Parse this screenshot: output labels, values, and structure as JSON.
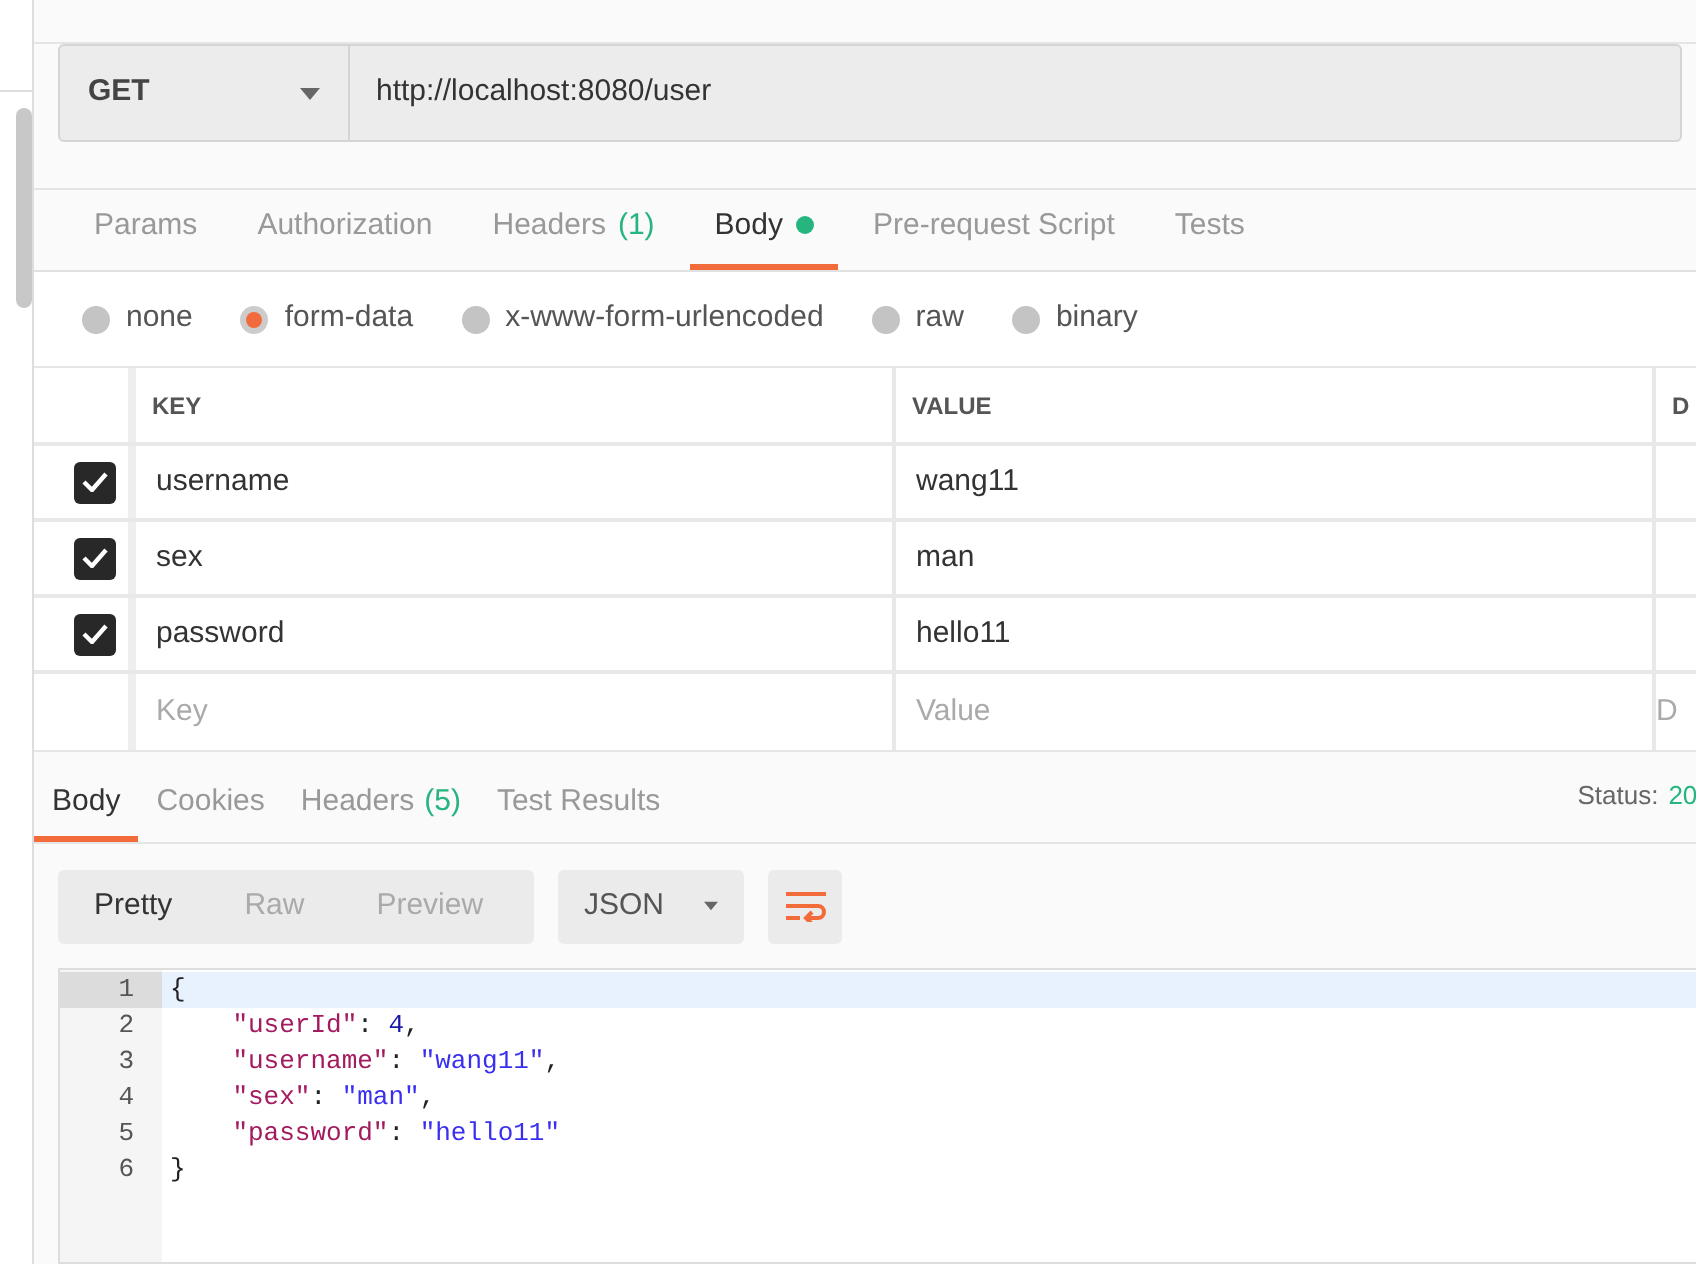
{
  "request": {
    "method": "GET",
    "url": "http://localhost:8080/user"
  },
  "request_tabs": [
    {
      "label": "Params",
      "selected": false
    },
    {
      "label": "Authorization",
      "selected": false
    },
    {
      "label": "Headers",
      "count": "(1)",
      "selected": false
    },
    {
      "label": "Body",
      "dot": true,
      "selected": true
    },
    {
      "label": "Pre-request Script",
      "selected": false
    },
    {
      "label": "Tests",
      "selected": false
    }
  ],
  "body_types": [
    {
      "label": "none",
      "selected": false
    },
    {
      "label": "form-data",
      "selected": true
    },
    {
      "label": "x-www-form-urlencoded",
      "selected": false
    },
    {
      "label": "raw",
      "selected": false
    },
    {
      "label": "binary",
      "selected": false
    }
  ],
  "params_table": {
    "columns": [
      "KEY",
      "VALUE",
      "D"
    ],
    "rows": [
      {
        "key": "username",
        "value": "wang11",
        "checked": true
      },
      {
        "key": "sex",
        "value": "man",
        "checked": true
      },
      {
        "key": "password",
        "value": "hello11",
        "checked": true
      }
    ],
    "new_row": {
      "key_placeholder": "Key",
      "value_placeholder": "Value",
      "column_3_placeholder": "D"
    }
  },
  "response_tabs": [
    {
      "label": "Body",
      "selected": true
    },
    {
      "label": "Cookies",
      "selected": false
    },
    {
      "label": "Headers",
      "count": "(5)",
      "selected": false
    },
    {
      "label": "Test Results",
      "selected": false
    }
  ],
  "status": {
    "label": "Status:",
    "value": "20"
  },
  "view_modes": [
    {
      "label": "Pretty",
      "selected": true
    },
    {
      "label": "Raw",
      "selected": false
    },
    {
      "label": "Preview",
      "selected": false
    }
  ],
  "format": "JSON",
  "code": [
    {
      "number": "1",
      "tokens": [
        {
          "kind": "punct",
          "text": "{"
        }
      ]
    },
    {
      "number": "2",
      "tokens": [
        {
          "kind": "key",
          "text": "    \"userId\""
        },
        {
          "kind": "punct",
          "text": ": "
        },
        {
          "kind": "number",
          "text": "4"
        },
        {
          "kind": "punct",
          "text": ","
        }
      ]
    },
    {
      "number": "3",
      "tokens": [
        {
          "kind": "key",
          "text": "    \"username\""
        },
        {
          "kind": "punct",
          "text": ": "
        },
        {
          "kind": "string",
          "text": "\"wang11\""
        },
        {
          "kind": "punct",
          "text": ","
        }
      ]
    },
    {
      "number": "4",
      "tokens": [
        {
          "kind": "key",
          "text": "    \"sex\""
        },
        {
          "kind": "punct",
          "text": ": "
        },
        {
          "kind": "string",
          "text": "\"man\""
        },
        {
          "kind": "punct",
          "text": ","
        }
      ]
    },
    {
      "number": "5",
      "tokens": [
        {
          "kind": "key",
          "text": "    \"password\""
        },
        {
          "kind": "punct",
          "text": ": "
        },
        {
          "kind": "string",
          "text": "\"hello11\""
        }
      ]
    },
    {
      "number": "6",
      "tokens": [
        {
          "kind": "punct",
          "text": "}"
        }
      ]
    }
  ]
}
